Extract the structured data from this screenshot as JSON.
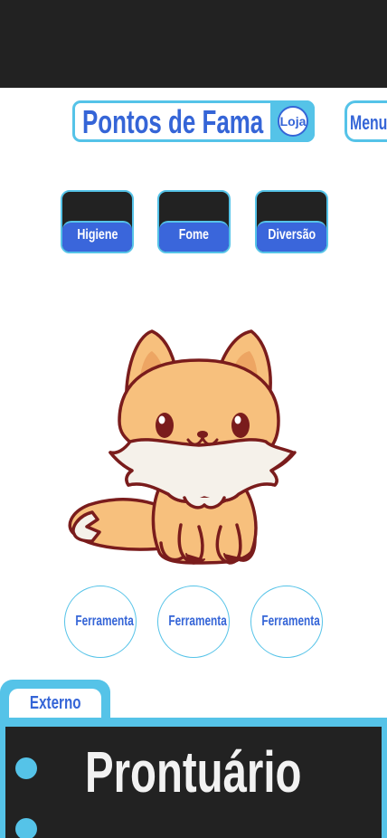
{
  "header": {
    "fame_label": "Pontos de Fama",
    "shop_label": "Loja",
    "menu_label": "Menu"
  },
  "stats": [
    {
      "label": "Higiene"
    },
    {
      "label": "Fome"
    },
    {
      "label": "Diversão"
    }
  ],
  "tools": [
    {
      "label": "Ferramenta"
    },
    {
      "label": "Ferramenta"
    },
    {
      "label": "Ferramenta"
    }
  ],
  "bottom": {
    "tab_label": "Externo",
    "panel_title": "Prontuário"
  },
  "colors": {
    "accent": "#55c3e8",
    "primary": "#3565d7",
    "dark": "#222222",
    "fox_orange": "#f7c07d",
    "fox_outline": "#7a1c1c"
  },
  "pet": {
    "image": "fox-pet"
  }
}
